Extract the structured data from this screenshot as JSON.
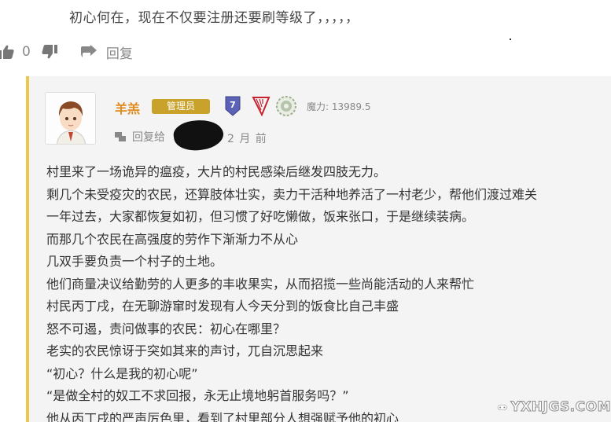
{
  "parent_comment": {
    "text": "初心何在，现在不仅要注册还要刷等级了，，，，，",
    "like_count": "0",
    "reply_label": "回复",
    "icons": {
      "like": "thumbs-up-icon",
      "dislike": "thumbs-down-icon",
      "reply": "reply-arrow-icon"
    }
  },
  "reply": {
    "accent_color": "#e9c84d",
    "username": "羊羔",
    "role_badge": "管理员",
    "level": "7",
    "power_label": "魔力: 13989.5",
    "reply_to_label": "回复给",
    "timestamp": "2 月 前",
    "icons": {
      "harp": "harp-icon",
      "medal": "medal-icon",
      "reply_to": "speech-bubble-icon",
      "avatar": "avatar"
    },
    "lines": [
      "村里来了一场诡异的瘟疫，大片的村民感染后继发四肢无力。",
      "剩几个未受疫灾的农民，还算肢体壮实，卖力干活种地养活了一村老少，帮他们渡过难关",
      "一年过去，大家都恢复如初，但习惯了好吃懒做，饭来张口，于是继续装病。",
      "而那几个农民在高强度的劳作下渐渐力不从心",
      "几双手要负责一个村子的土地。",
      "他们商量决议给勤劳的人更多的丰收果实，从而招揽一些尚能活动的人来帮忙",
      "村民丙丁戌，在无聊游窜时发现有人今天分到的饭食比自己丰盛",
      "怒不可遏，责问做事的农民：初心在哪里？",
      "老实的农民惊讶于突如其来的声讨，兀自沉思起来",
      "“初心？什么是我的初心呢”",
      "“是做全村的奴工不求回报，永无止境地躬首服务吗？”",
      "他从丙丁戌的严声厉色里，看到了村里部分人想强赋予他的初心"
    ]
  },
  "watermark": {
    "text": "YXHJGS.COM"
  }
}
